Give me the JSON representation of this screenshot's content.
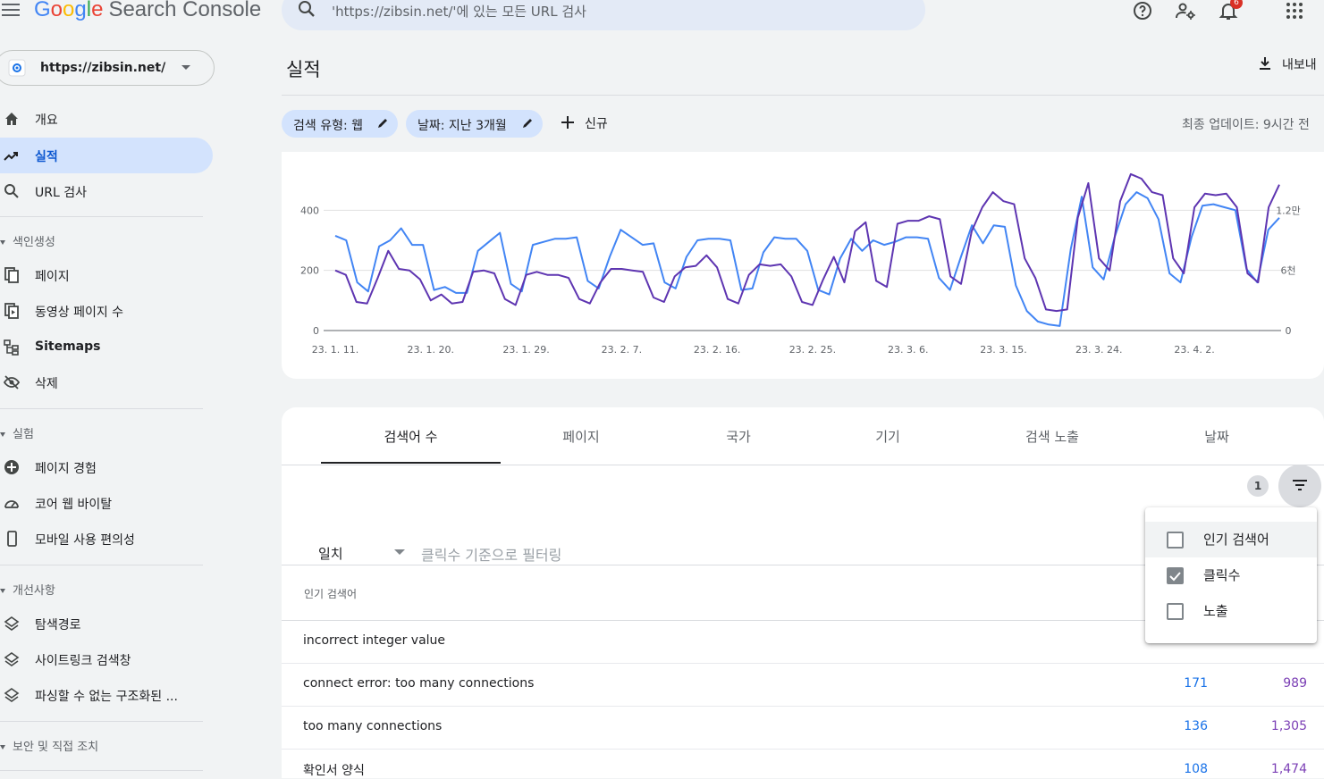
{
  "header": {
    "logo": {
      "letters": [
        "G",
        "o",
        "o",
        "g",
        "l",
        "e"
      ],
      "product": "Search Console"
    },
    "search_placeholder": "'https://zibsin.net/'에 있는 모든 URL 검사",
    "notification_count": "6"
  },
  "sidebar": {
    "property": "https://zibsin.net/",
    "items_top": [
      {
        "label": "개요",
        "icon": "home-icon"
      },
      {
        "label": "실적",
        "icon": "trending-up-icon",
        "active": true
      },
      {
        "label": "URL 검사",
        "icon": "search-icon"
      }
    ],
    "sections": [
      {
        "title": "색인생성",
        "items": [
          "페이지",
          "동영상 페이지 수",
          "Sitemaps",
          "삭제"
        ]
      },
      {
        "title": "실험",
        "items": [
          "페이지 경험",
          "코어 웹 바이탈",
          "모바일 사용 편의성"
        ]
      },
      {
        "title": "개선사항",
        "items": [
          "탐색경로",
          "사이트링크 검색창",
          "파싱할 수 없는 구조화된 ..."
        ]
      },
      {
        "title": "보안 및 직접 조치",
        "items": []
      }
    ]
  },
  "main": {
    "title": "실적",
    "export_label": "내보내",
    "chips": [
      "검색 유형: 웹",
      "날짜: 지난 3개월"
    ],
    "new_label": "신규",
    "last_updated": "최종 업데이트: 9시간 전",
    "tabs": [
      "검색어 수",
      "페이지",
      "국가",
      "기기",
      "검색 노출",
      "날짜"
    ],
    "filter": {
      "count": "1",
      "match": "일치",
      "placeholder": "클릭수 기준으로 필터링"
    },
    "table": {
      "column_header": "인기 검색어",
      "rows": [
        {
          "query": "incorrect integer value",
          "clicks": "",
          "impressions": ""
        },
        {
          "query": "connect error: too many connections",
          "clicks": "171",
          "impressions": "989"
        },
        {
          "query": "too many connections",
          "clicks": "136",
          "impressions": "1,305"
        },
        {
          "query": "확인서 양식",
          "clicks": "108",
          "impressions": "1,474"
        }
      ]
    },
    "column_menu": [
      {
        "label": "인기 검색어",
        "checked": false
      },
      {
        "label": "클릭수",
        "checked": true
      },
      {
        "label": "노출",
        "checked": false
      }
    ]
  },
  "chart_data": {
    "type": "line",
    "title": "",
    "x_tick_labels": [
      "23. 1. 11.",
      "23. 1. 20.",
      "23. 1. 29.",
      "23. 2. 7.",
      "23. 2. 16.",
      "23. 2. 25.",
      "23. 3. 6.",
      "23. 3. 15.",
      "23. 3. 24.",
      "23. 4. 2."
    ],
    "x_start": "2023-01-11",
    "x_end": "2023-04-10",
    "y_left": {
      "ticks": [
        "0",
        "200",
        "400"
      ],
      "ylim": [
        0,
        600
      ]
    },
    "y_right": {
      "ticks": [
        "0",
        "6천",
        "1.2만"
      ],
      "ylim": [
        0,
        18000
      ]
    },
    "grid": true,
    "colors": {
      "clicks": "#4285f4",
      "impressions": "#5e35b1"
    },
    "series": [
      {
        "key": "clicks",
        "axis": "left",
        "values": [
          315,
          300,
          160,
          130,
          280,
          300,
          340,
          285,
          285,
          135,
          145,
          125,
          125,
          265,
          295,
          325,
          155,
          130,
          285,
          295,
          305,
          305,
          310,
          165,
          140,
          245,
          335,
          310,
          285,
          290,
          160,
          140,
          245,
          300,
          305,
          305,
          300,
          135,
          140,
          260,
          310,
          305,
          305,
          265,
          135,
          120,
          240,
          305,
          265,
          300,
          285,
          295,
          310,
          310,
          305,
          175,
          135,
          245,
          350,
          290,
          350,
          345,
          150,
          65,
          30,
          20,
          15,
          270,
          445,
          210,
          170,
          310,
          420,
          460,
          440,
          370,
          190,
          160,
          310,
          415,
          420,
          410,
          400,
          205,
          160,
          335,
          375
        ]
      },
      {
        "key": "impressions",
        "axis": "left",
        "values": [
          200,
          185,
          95,
          90,
          175,
          265,
          205,
          200,
          170,
          100,
          120,
          90,
          95,
          195,
          200,
          190,
          105,
          85,
          185,
          195,
          185,
          185,
          175,
          105,
          90,
          160,
          205,
          205,
          200,
          195,
          110,
          95,
          180,
          210,
          215,
          250,
          210,
          105,
          90,
          185,
          220,
          215,
          220,
          180,
          95,
          85,
          170,
          245,
          160,
          330,
          360,
          165,
          145,
          355,
          365,
          365,
          380,
          370,
          180,
          155,
          330,
          410,
          460,
          430,
          420,
          240,
          175,
          70,
          65,
          70,
          375,
          490,
          240,
          200,
          430,
          520,
          505,
          460,
          450,
          240,
          190,
          410,
          455,
          450,
          455,
          410,
          190,
          160,
          410,
          485
        ]
      }
    ]
  }
}
